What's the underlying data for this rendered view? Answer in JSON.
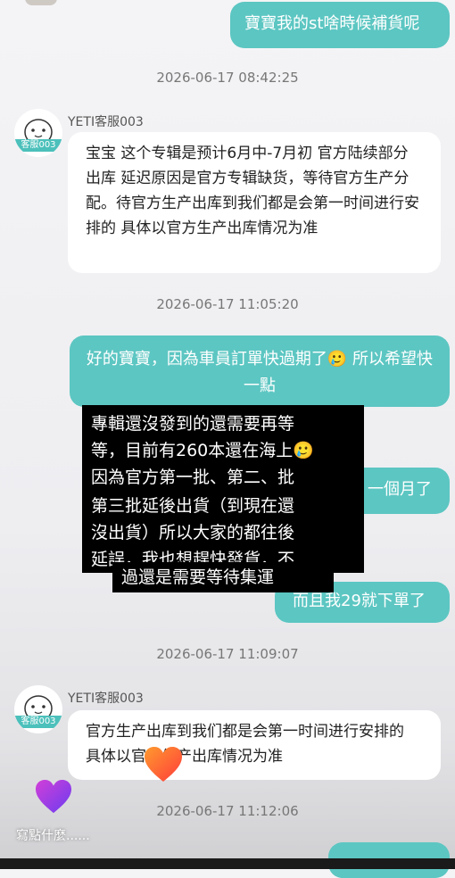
{
  "messages": {
    "msg1": "寶寶我的st啥時候補貨呢",
    "ts1": "2026-06-17 08:42:25",
    "agent_name": "YETI客服003",
    "avatar_label": "客服003",
    "msg2": "宝宝  这个专辑是预计6月中-7月初 官方陆续部分出库   延迟原因是官方专辑缺货，等待官方生产分配。待官方生产出库到我们都是会第一时间进行安排的  具体以官方生产出库情况为准",
    "ts2": "2026-06-17 11:05:20",
    "msg3": "好的寶寶，因為車員訂單快過期了🥲 所以希望快一點",
    "msg4_visible": "一個月了",
    "msg5": "而且我29就下單了",
    "ts3": "2026-06-17 11:09:07",
    "msg6": "官方生产出库到我们都是会第一时间进行安排的  具体以官方生产出库情况为准",
    "ts4": "2026-06-17 11:12:06"
  },
  "overlay": {
    "line1": "專輯還沒發到的還需要再等",
    "line2": "等，目前有260本還在海上🥲",
    "line3": "因為官方第一批、第二、批",
    "line4": "第三批延後出貨（到現在還",
    "line5": "沒出貨）所以大家的都往後",
    "line6": "延誤，我也想趕快發貨，不",
    "line7": "過還是需要等待集運"
  },
  "footer": {
    "input_placeholder": "寫點什麼......"
  },
  "colors": {
    "outgoing_bubble": "#5cc6c2",
    "incoming_bubble": "#ffffff",
    "agent_tag": "#4cc0bb"
  }
}
